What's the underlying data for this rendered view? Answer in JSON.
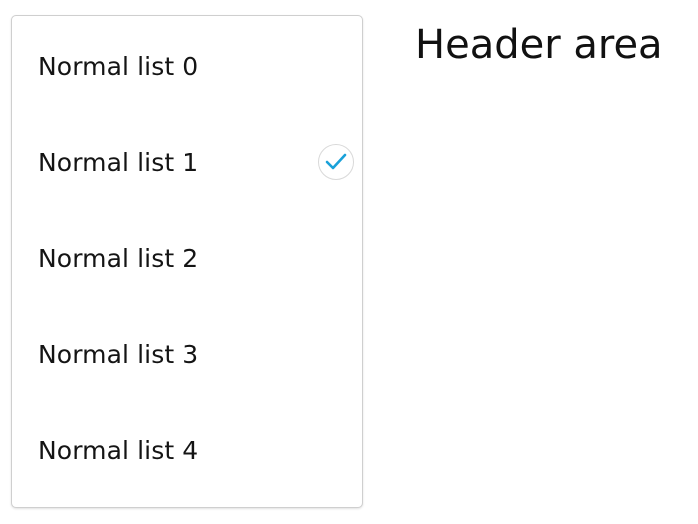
{
  "list": {
    "items": [
      {
        "label": "Normal list 0",
        "checked": false
      },
      {
        "label": "Normal list 1",
        "checked": true
      },
      {
        "label": "Normal list 2",
        "checked": false
      },
      {
        "label": "Normal list 3",
        "checked": false
      },
      {
        "label": "Normal list 4",
        "checked": false
      }
    ],
    "check_icon": "checkmark-icon",
    "check_color": "#1aa1d9"
  },
  "header": {
    "title": "Header area"
  }
}
